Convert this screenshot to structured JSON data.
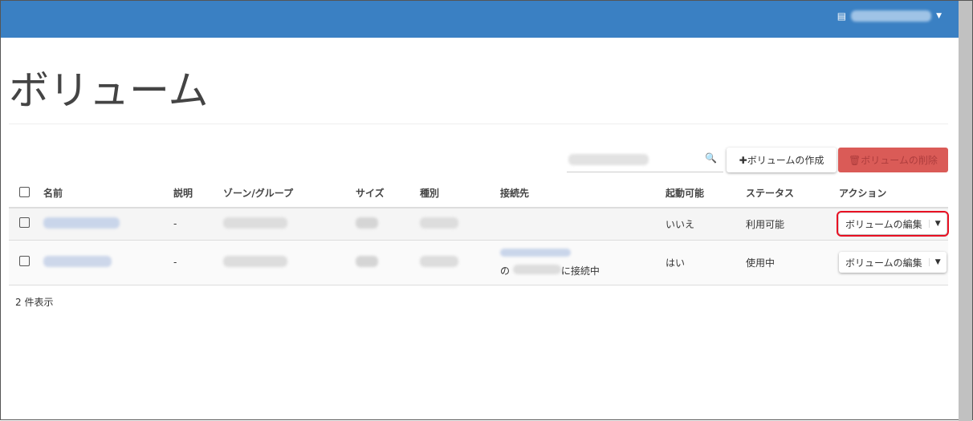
{
  "header": {
    "user_icon": "id-card-icon",
    "user_name_blurred": true
  },
  "page_title": "ボリューム",
  "toolbar": {
    "search_placeholder": "",
    "search_icon": "search-icon",
    "create_label": "✚ボリュームの作成",
    "delete_label": "🗑ボリュームの削除"
  },
  "table": {
    "headers": [
      "名前",
      "説明",
      "ゾーン/グループ",
      "サイズ",
      "種別",
      "接続先",
      "起動可能",
      "ステータス",
      "アクション"
    ],
    "rows": [
      {
        "description": "-",
        "attached_prefix": "",
        "attached_suffix": "",
        "bootable": "いいえ",
        "status": "利用可能",
        "action": "ボリュームの編集"
      },
      {
        "description": "-",
        "attached_prefix": "の",
        "attached_suffix": "に接続中",
        "bootable": "はい",
        "status": "使用中",
        "action": "ボリュームの編集"
      }
    ]
  },
  "footer": {
    "count": "2 件表示"
  },
  "colors": {
    "header": "#3a80c3",
    "danger": "#d9534f",
    "highlight": "#e81123"
  }
}
